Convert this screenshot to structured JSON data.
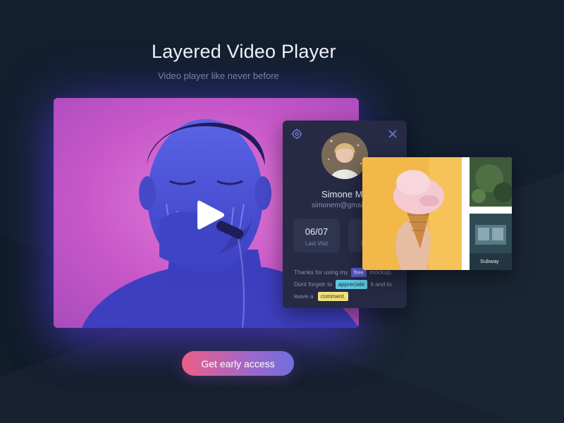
{
  "hero": {
    "title": "Layered Video Player",
    "subtitle": "Video player like never before"
  },
  "video": {
    "play_icon": "play-icon"
  },
  "profile": {
    "settings_icon": "gear-icon",
    "close_icon": "close-icon",
    "name": "Simone Mi",
    "email": "simonem@gmai",
    "stats": [
      {
        "value": "06/07",
        "label": "Last Visit"
      },
      {
        "value": "",
        "label": "E"
      }
    ],
    "message": {
      "line1_pre": "Thanks for using my",
      "tag_free": "free",
      "line1_post": "mockup.",
      "line2_pre": "Dont forgetr to",
      "tag_appreciate": "appreciate",
      "line2_post": "it and to",
      "line3_pre": "leave  a",
      "tag_comment": "comment."
    }
  },
  "gallery": {
    "caption": "Subway"
  },
  "cta": {
    "label": "Get early access"
  },
  "colors": {
    "background": "#14202f",
    "panel": "#262a44",
    "accent_pink": "#ec5f87",
    "accent_purple": "#6f6fe0",
    "tag_free": "#5a55c8",
    "tag_appreciate": "#5ec8e0",
    "tag_comment": "#f1e27a"
  }
}
